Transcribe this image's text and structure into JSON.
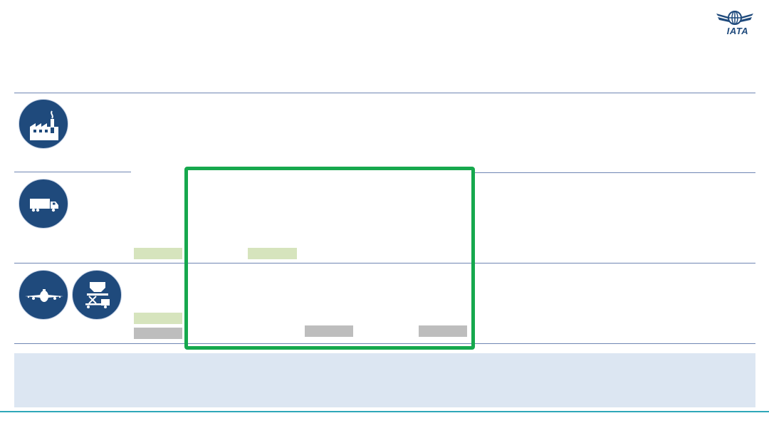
{
  "brand": {
    "logo_text": "IATA",
    "color_primary": "#1f4a7c",
    "color_highlight": "#16a84d",
    "color_chip_green": "#d6e4bd",
    "color_chip_grey": "#bdbdbd",
    "color_footer": "#dce6f2"
  },
  "rows": [
    {
      "id": "manufacturer",
      "icons": [
        "factory-icon"
      ]
    },
    {
      "id": "trucking",
      "icons": [
        "truck-icon"
      ]
    },
    {
      "id": "airline-handling",
      "icons": [
        "airplane-icon",
        "cargo-loader-icon"
      ]
    }
  ],
  "chips": [
    {
      "row": "trucking",
      "color": "green"
    },
    {
      "row": "trucking",
      "color": "green"
    },
    {
      "row": "airline-handling",
      "color": "green"
    },
    {
      "row": "airline-handling",
      "color": "grey"
    },
    {
      "row": "airline-handling",
      "color": "grey"
    },
    {
      "row": "airline-handling",
      "color": "grey"
    }
  ]
}
